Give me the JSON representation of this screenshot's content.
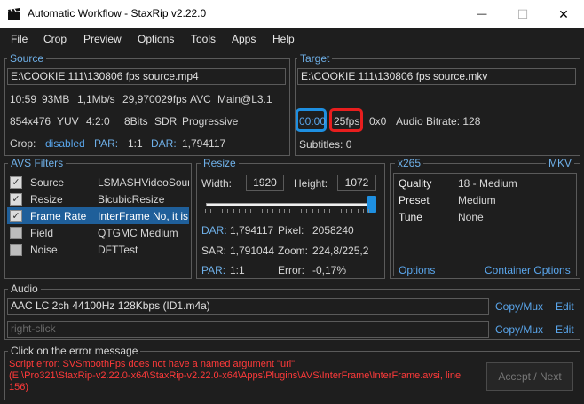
{
  "window": {
    "title": "Automatic Workflow - StaxRip v2.22.0",
    "minimize_glyph": "—",
    "maximize_glyph": "☐",
    "close_glyph": "✕"
  },
  "menu": [
    "File",
    "Crop",
    "Preview",
    "Options",
    "Tools",
    "Apps",
    "Help"
  ],
  "source": {
    "title": "Source",
    "path": "E:\\COOKIE 111\\130806 fps source.mp4",
    "row1": [
      "10:59",
      "93MB",
      "1,1Mb/s",
      "29,970029fps",
      "AVC",
      "Main@L3.1"
    ],
    "row2": [
      "854x476",
      "YUV",
      "4:2:0",
      "8Bits",
      "SDR",
      "Progressive"
    ],
    "crop_label": "Crop:",
    "crop_value": "disabled",
    "par_label": "PAR:",
    "par_value": "1:1",
    "dar_label": "DAR:",
    "dar_value": "1,794117"
  },
  "target": {
    "title": "Target",
    "path": "E:\\COOKIE 111\\130806 fps source.mkv",
    "duration": "00:00",
    "fps": "25fps",
    "size": "0x0",
    "audio_bitrate": "Audio Bitrate: 128",
    "subtitles": "Subtitles: 0",
    "highlight_duration_color": "#1e8fe0",
    "highlight_fps_color": "#e81e1e"
  },
  "avs_filters": {
    "title": "AVS Filters",
    "rows": [
      {
        "checked": true,
        "name": "Source",
        "value": "LSMASHVideoSource",
        "selected": false
      },
      {
        "checked": true,
        "name": "Resize",
        "value": "BicubicResize",
        "selected": false
      },
      {
        "checked": true,
        "name": "Frame Rate",
        "value": "InterFrame No, it is",
        "selected": true
      },
      {
        "checked": false,
        "name": "Field",
        "value": "QTGMC Medium",
        "selected": false
      },
      {
        "checked": false,
        "name": "Noise",
        "value": "DFTTest",
        "selected": false
      }
    ],
    "check_glyph": "✓"
  },
  "resize": {
    "title": "Resize",
    "width_label": "Width:",
    "width_value": "1920",
    "height_label": "Height:",
    "height_value": "1072",
    "slider_level": 1.0,
    "dar_label": "DAR:",
    "dar_value": "1,794117",
    "pixel_label": "Pixel:",
    "pixel_value": "2058240",
    "sar_label": "SAR:",
    "sar_value": "1,791044",
    "zoom_label": "Zoom:",
    "zoom_value": "224,8/225,2",
    "par_label": "PAR:",
    "par_value": "1:1",
    "error_label": "Error:",
    "error_value": "-0,17%"
  },
  "encoder": {
    "title_left": "x265",
    "title_right": "MKV",
    "rows": [
      {
        "label": "Quality",
        "value": "18 - Medium"
      },
      {
        "label": "Preset",
        "value": "Medium"
      },
      {
        "label": "Tune",
        "value": "None"
      }
    ],
    "options_link": "Options",
    "container_link": "Container Options"
  },
  "audio": {
    "title": "Audio",
    "track1": "AAC LC 2ch 44100Hz 128Kbps (ID1.m4a)",
    "track2_placeholder": "right-click",
    "copy_mux": "Copy/Mux",
    "edit": "Edit"
  },
  "error_panel": {
    "title": "Click on the error message",
    "line1": "Script error: SVSmoothFps does not have a named argument \"url\"",
    "line2": "(E:\\Pro321\\StaxRip-v2.22.0-x64\\StaxRip-v2.22.0-x64\\Apps\\Plugins\\AVS\\InterFrame\\InterFrame.avsi, line",
    "line3": "156)",
    "accept_next": "Accept / Next"
  }
}
